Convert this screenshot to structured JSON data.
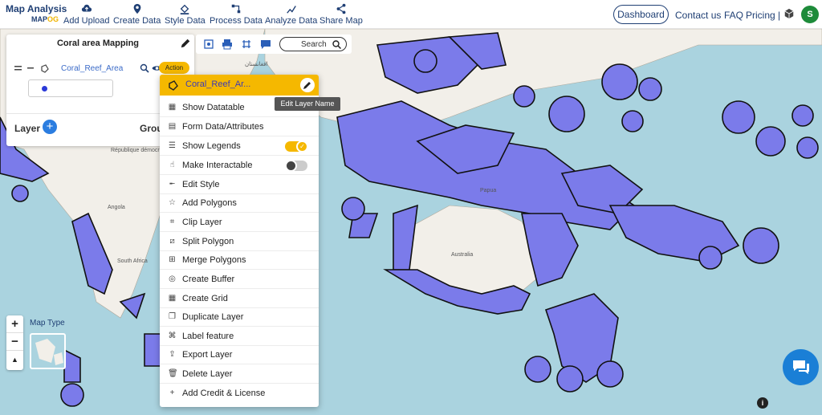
{
  "brand": {
    "line1": "Map Analysis",
    "line2_a": "MAP",
    "line2_b": "OG"
  },
  "nav": {
    "items": [
      {
        "label": "Add Upload",
        "icon": "cloud-upload-icon"
      },
      {
        "label": "Create Data",
        "icon": "map-pin-icon"
      },
      {
        "label": "Style Data",
        "icon": "paint-bucket-icon"
      },
      {
        "label": "Process Data",
        "icon": "process-icon"
      },
      {
        "label": "Analyze Data",
        "icon": "analyze-icon"
      },
      {
        "label": "Share Map",
        "icon": "share-icon"
      }
    ],
    "dashboard": "Dashboard",
    "contact": "Contact us",
    "faq": "FAQ",
    "pricing": "Pricing |",
    "avatar_initial": "S"
  },
  "panel": {
    "title": "Coral area Mapping",
    "layer_name": "Coral_Reef_Area",
    "action_label": "Action",
    "layer_label": "Layer",
    "group_label": "Group"
  },
  "map_toolbar": {
    "search_label": "Search"
  },
  "dropdown": {
    "header_name": "Coral_Reef_Ar...",
    "tooltip": "Edit Layer Name",
    "items": [
      {
        "label": "Show Datatable",
        "icon": "table-icon"
      },
      {
        "label": "Form Data/Attributes",
        "icon": "form-icon"
      },
      {
        "label": "Show Legends",
        "icon": "list-icon",
        "toggle": "on"
      },
      {
        "label": "Make Interactable",
        "icon": "pointer-icon",
        "toggle": "off"
      },
      {
        "label": "Edit Style",
        "icon": "edit-style-icon"
      },
      {
        "label": "Add Polygons",
        "icon": "polygon-icon"
      },
      {
        "label": "Clip Layer",
        "icon": "crop-icon"
      },
      {
        "label": "Split Polygon",
        "icon": "split-icon"
      },
      {
        "label": "Merge Polygons",
        "icon": "merge-icon"
      },
      {
        "label": "Create Buffer",
        "icon": "buffer-icon"
      },
      {
        "label": "Create Grid",
        "icon": "grid-icon"
      },
      {
        "label": "Duplicate Layer",
        "icon": "duplicate-icon"
      },
      {
        "label": "Label feature",
        "icon": "label-icon"
      },
      {
        "label": "Export Layer",
        "icon": "export-icon"
      },
      {
        "label": "Delete Layer",
        "icon": "trash-icon"
      },
      {
        "label": "Add Credit & License",
        "icon": "plus-icon"
      }
    ]
  },
  "map": {
    "labels": {
      "congo": "République démocratique du Congo",
      "angola": "Angola",
      "south_africa": "South Africa",
      "australia": "Australia",
      "papua": "Papua",
      "afghanistan": "افغانستان"
    },
    "map_type": "Map Type"
  },
  "zoom": {
    "in": "+",
    "out": "−",
    "north": "▲"
  },
  "colors": {
    "accent": "#f5b800",
    "polygon": "#7b7bea",
    "brand": "#1f3f74",
    "water": "#aad3df",
    "land": "#f2efe9"
  }
}
